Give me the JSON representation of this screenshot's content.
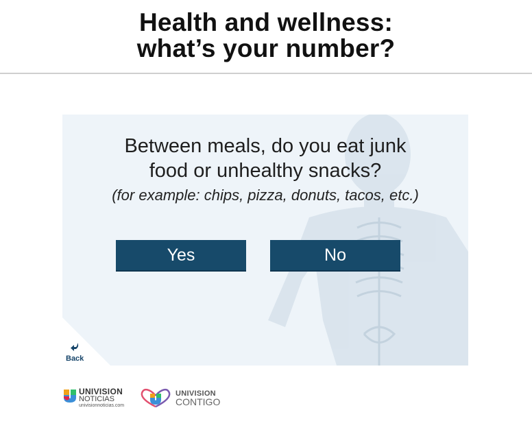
{
  "header": {
    "title_line1": "Health and wellness:",
    "title_line2": "what’s your number?"
  },
  "question": {
    "line1": "Between meals, do you eat junk",
    "line2": "food or unhealthy snacks?",
    "example": "(for example: chips, pizza, donuts, tacos, etc.)"
  },
  "answers": {
    "yes": "Yes",
    "no": "No"
  },
  "nav": {
    "back_label": "Back",
    "back_icon": "back-arrow-icon"
  },
  "logos": {
    "univision_noticias": {
      "name": "UNIVISION",
      "sub": "NOTICIAS",
      "url": "univisionnoticias.com"
    },
    "univision_contigo": {
      "name": "UNIVISION",
      "sub": "CONTIGO"
    }
  },
  "colors": {
    "button_bg": "#174a6a",
    "card_bg": "#eef4f9",
    "back_text": "#17456a"
  }
}
